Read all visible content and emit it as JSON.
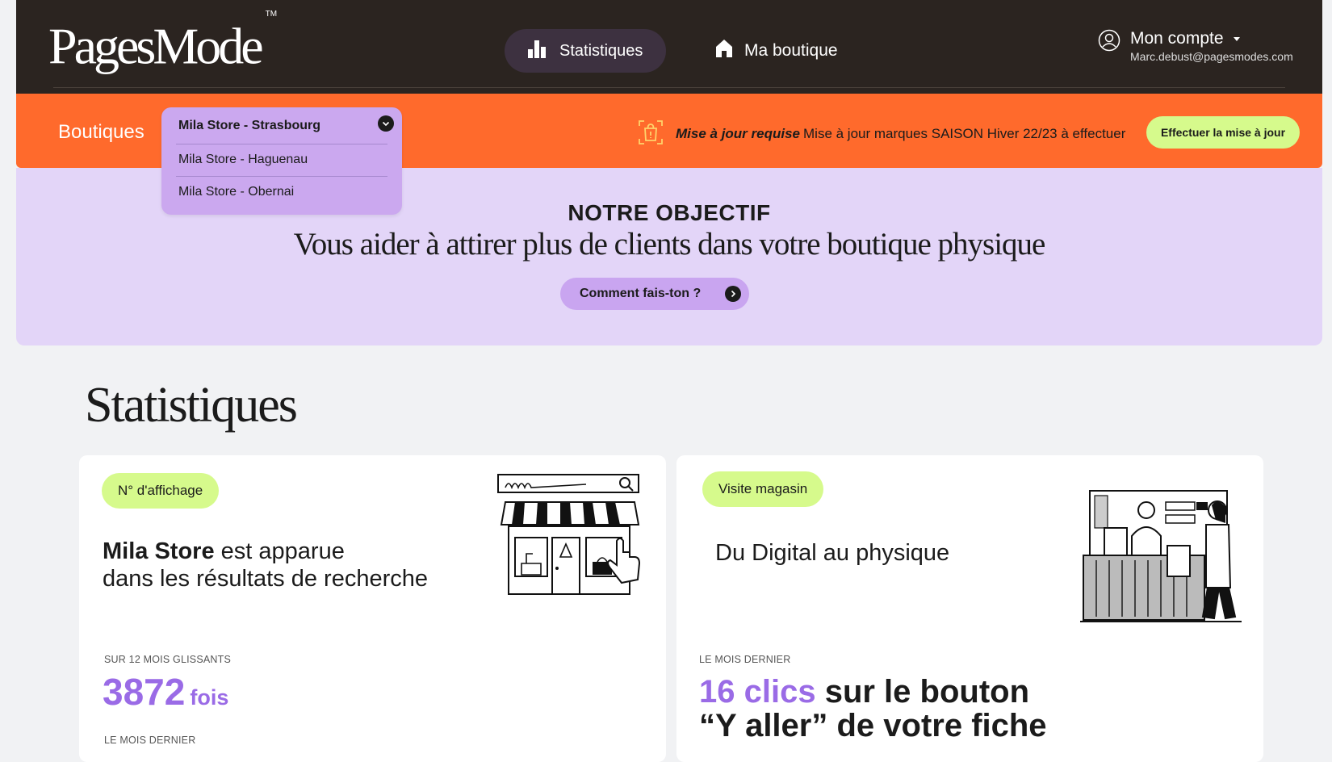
{
  "brand": {
    "logo_text": "PagesMode",
    "trademark": "TM"
  },
  "nav": {
    "stats_label": "Statistiques",
    "shop_label": "Ma boutique"
  },
  "account": {
    "label": "Mon compte",
    "email": "Marc.debust@pagesmodes.com"
  },
  "store_bar": {
    "label": "Boutiques",
    "selected": "Mila Store - Strasbourg",
    "options": [
      "Mila Store -  Haguenau",
      "Mila Store - Obernai"
    ],
    "update_title": "Mise à jour requise",
    "update_message": "Mise à jour marques SAISON Hiver 22/23 à effectuer",
    "update_button": "Effectuer la mise à jour"
  },
  "objective": {
    "title": "NOTRE OBJECTIF",
    "subtitle": "Vous aider à attirer plus de clients dans votre boutique physique",
    "button": "Comment fais-ton ?"
  },
  "stats": {
    "title": "Statistiques",
    "cards": [
      {
        "tag": "N° d'affichage",
        "headline_bold": "Mila Store",
        "headline_rest": " est apparue",
        "headline_line2": "dans les résultats de recherche",
        "caption1": "SUR 12 MOIS GLISSANTS",
        "value": "3872",
        "unit": "fois",
        "caption2": "LE MOIS DERNIER"
      },
      {
        "tag": "Visite magasin",
        "headline": "Du Digital au physique",
        "caption1": "LE MOIS DERNIER",
        "clicks_highlight": "16 clics",
        "clicks_rest": " sur le bouton",
        "clicks_line2": "“Y aller” de votre fiche"
      }
    ]
  },
  "colors": {
    "header_bg": "#2b2420",
    "orange": "#ff6a2c",
    "lavender": "#e3d5f8",
    "purple_accent": "#9a6be6",
    "lime": "#d6fa8c"
  }
}
